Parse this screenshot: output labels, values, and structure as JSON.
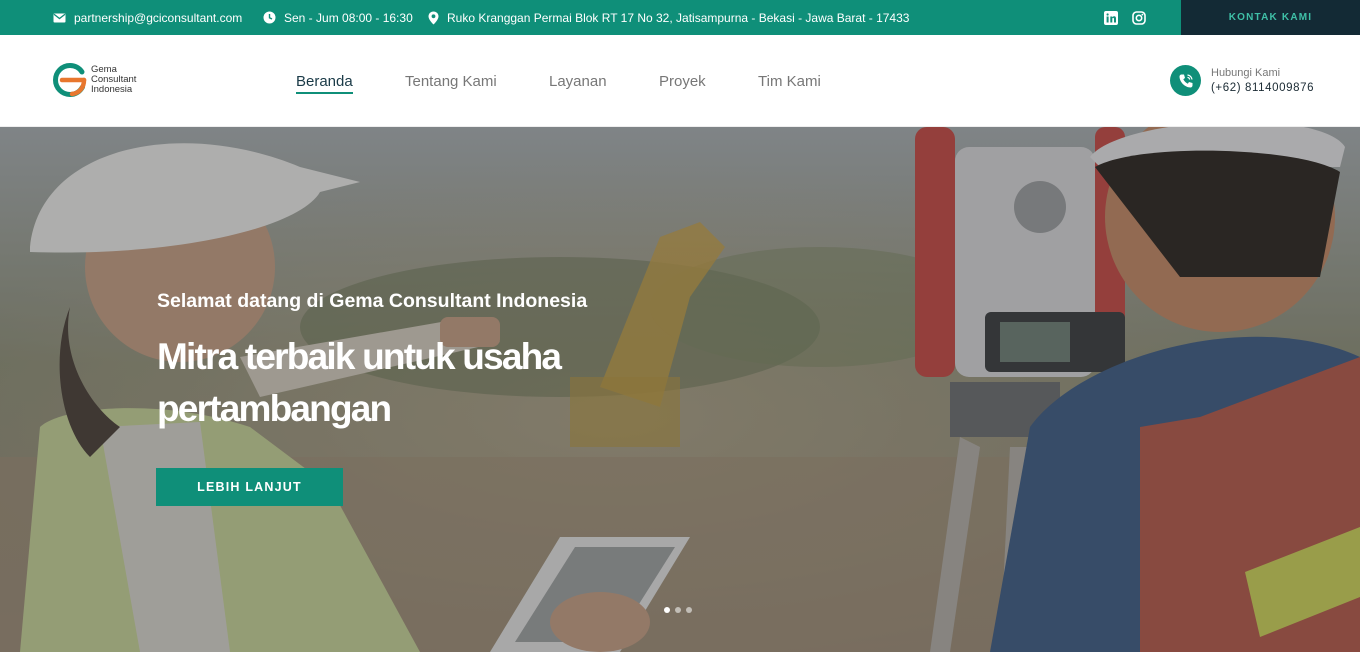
{
  "topbar": {
    "email": "partnership@gciconsultant.com",
    "hours": "Sen - Jum 08:00 - 16:30",
    "address": "Ruko Kranggan Permai Blok RT 17 No 32, Jatisampurna - Bekasi - Jawa Barat - 17433",
    "social": [
      "linkedin-icon",
      "instagram-icon"
    ],
    "contact_button": "KONTAK KAMI"
  },
  "header": {
    "logo_lines": [
      "Gema",
      "Consultant",
      "Indonesia"
    ],
    "nav": [
      {
        "label": "Beranda",
        "active": true
      },
      {
        "label": "Tentang Kami",
        "active": false
      },
      {
        "label": "Layanan",
        "active": false
      },
      {
        "label": "Proyek",
        "active": false
      },
      {
        "label": "Tim Kami",
        "active": false
      }
    ],
    "call_label": "Hubungi Kami",
    "call_phone": "(+62) 8114009876"
  },
  "hero": {
    "subtitle": "Selamat datang di Gema Consultant Indonesia",
    "title": "Mitra terbaik untuk usaha pertambangan",
    "button": "LEBIH LANJUT",
    "slides_total": 3,
    "slide_active": 1
  },
  "colors": {
    "brand_green": "#0f8f79",
    "dark_navy": "#132a35",
    "logo_orange": "#e8772e"
  }
}
